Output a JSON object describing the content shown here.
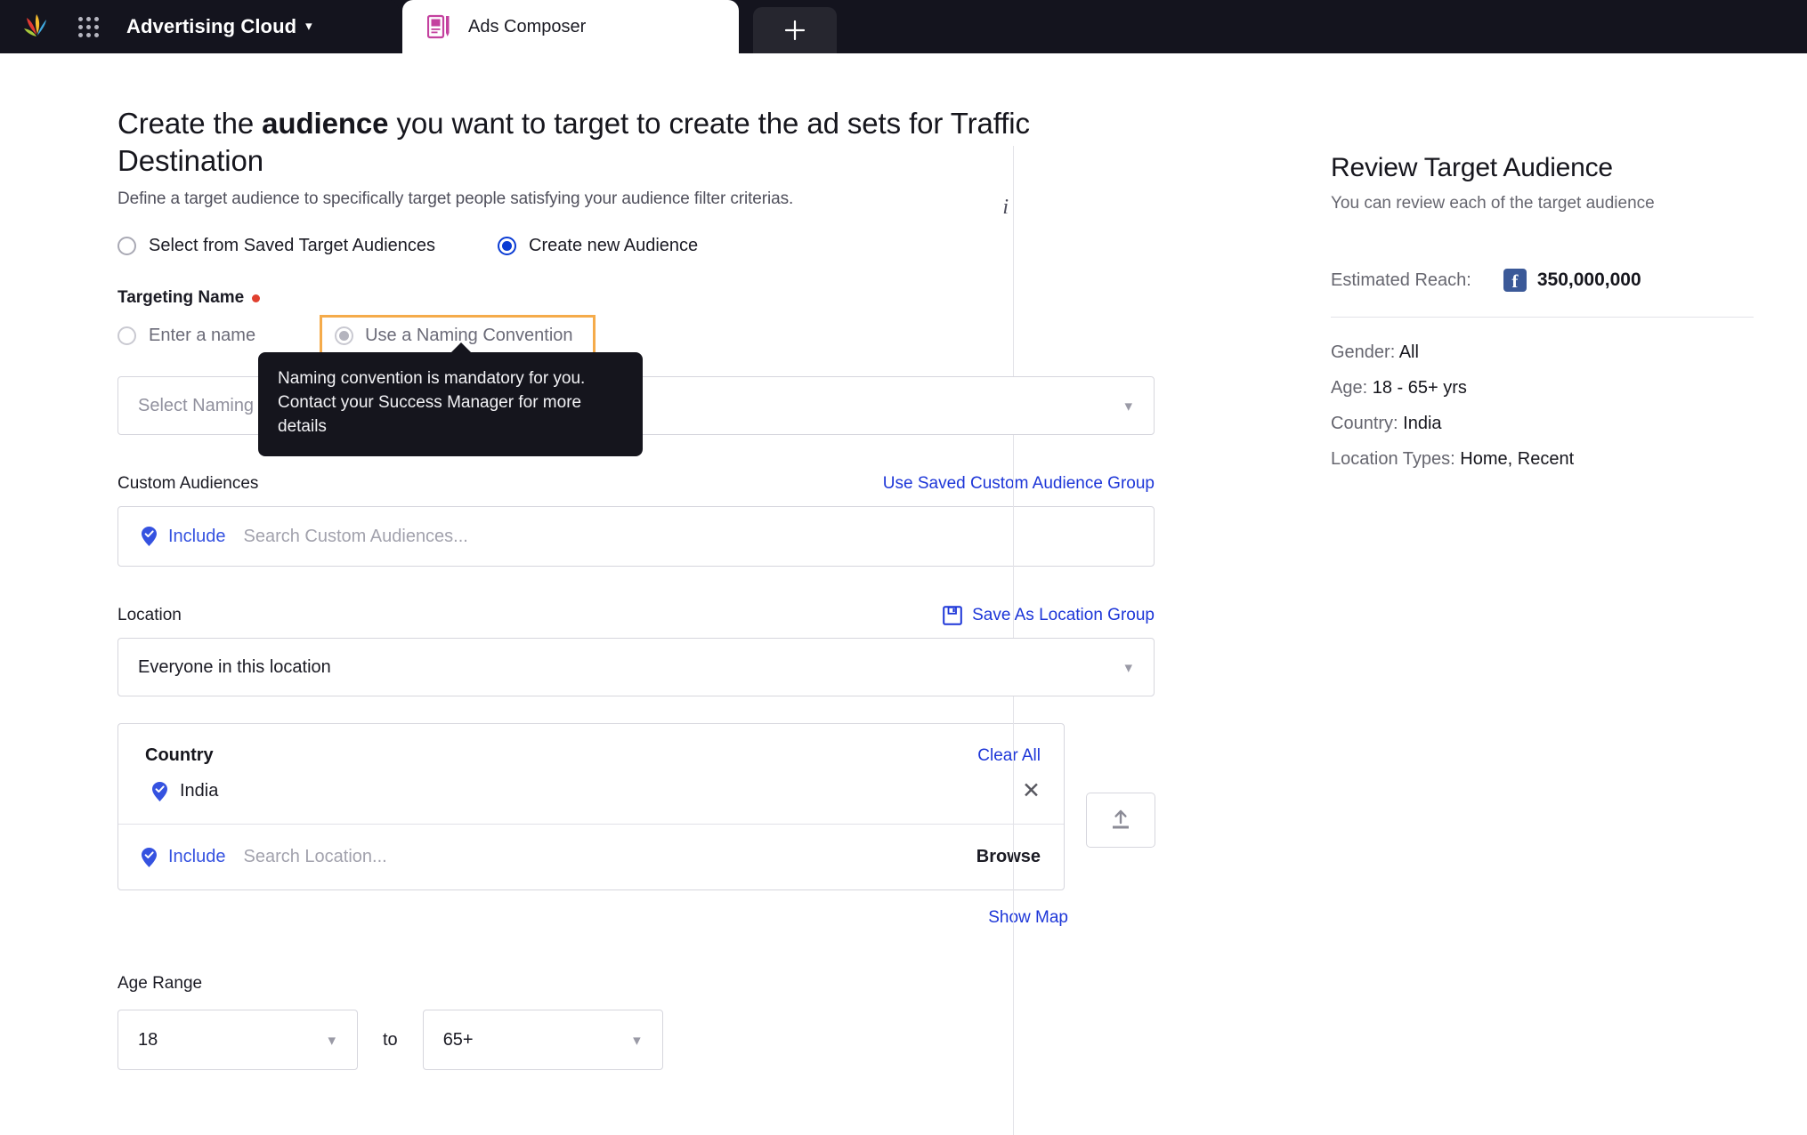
{
  "topbar": {
    "logo_icon": "sprinklr-splash-logo",
    "apps_grid_icon": "apps-grid-icon",
    "brand": "Advertising Cloud",
    "brand_caret_icon": "chevron-down-icon",
    "tab": {
      "label": "Ads Composer",
      "icon": "ads-composer-icon"
    },
    "new_tab_icon": "plus-icon"
  },
  "main": {
    "headline_pre": "Create the ",
    "headline_bold": "audience",
    "headline_post": " you want to target to create the ad sets for Traffic Destination",
    "subhead": "Define a target audience to specifically target people satisfying your audience filter criterias.",
    "info_icon": "info-icon",
    "audience_mode": {
      "option_saved": "Select from Saved Target Audiences",
      "option_new": "Create new Audience",
      "selected": "Create new Audience"
    },
    "targeting_name": {
      "label": "Targeting Name",
      "required": true,
      "option_enter": "Enter a name",
      "option_convention": "Use a Naming Convention",
      "selected": "Use a Naming Convention",
      "tooltip": "Naming convention is mandatory for you. Contact your Success Manager for more details",
      "dropdown_placeholder": "Select Naming Convention",
      "dropdown_value": "",
      "chevron_icon": "chevron-down-icon"
    },
    "custom_audiences": {
      "title": "Custom Audiences",
      "saved_group_link": "Use Saved Custom Audience Group",
      "include_label": "Include",
      "include_icon": "pin-check-icon",
      "search_placeholder": "Search Custom Audiences...",
      "search_value": ""
    },
    "location": {
      "title": "Location",
      "save_group_link": "Save As Location Group",
      "save_icon": "floppy-save-icon",
      "scope_value": "Everyone in this location",
      "scope_chevron_icon": "chevron-down-icon",
      "country_title": "Country",
      "clear_all": "Clear All",
      "countries": [
        {
          "name": "India",
          "icon": "pin-check-icon",
          "remove_icon": "close-icon"
        }
      ],
      "include_label": "Include",
      "include_icon": "pin-check-icon",
      "search_placeholder": "Search Location...",
      "search_value": "",
      "browse_label": "Browse",
      "upload_icon": "upload-icon",
      "show_map_link": "Show Map"
    },
    "age_range": {
      "label": "Age Range",
      "from_value": "18",
      "to_label": "to",
      "to_value": "65+",
      "chevron_icon": "chevron-down-icon"
    }
  },
  "review_panel": {
    "title": "Review Target Audience",
    "subtitle": "You can review each of the target audience",
    "reach_label": "Estimated Reach:",
    "reach_platform_icon": "facebook-icon",
    "reach_value": "350,000,000",
    "attributes": [
      {
        "key": "Gender:",
        "value": "All"
      },
      {
        "key": "Age:",
        "value": "18 - 65+ yrs"
      },
      {
        "key": "Country:",
        "value": "India"
      },
      {
        "key": "Location Types:",
        "value": "Home, Recent"
      }
    ]
  },
  "colors": {
    "topbar_bg": "#14141e",
    "accent_blue": "#1d36d8",
    "radio_blue": "#0b3cd4",
    "highlight_orange": "#f5ab4a",
    "required_red": "#e0402f",
    "tooltip_bg": "#15151d",
    "tab_icon_magenta": "#c4419f",
    "facebook_blue": "#3b5998"
  }
}
